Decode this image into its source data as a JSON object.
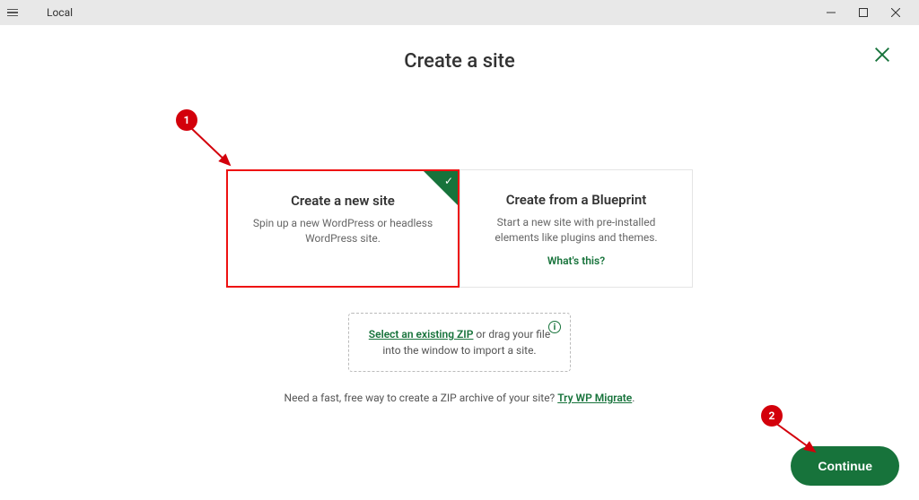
{
  "window": {
    "title": "Local"
  },
  "dialog": {
    "title": "Create a site"
  },
  "options": {
    "new_site": {
      "title": "Create a new site",
      "description": "Spin up a new WordPress or headless WordPress site."
    },
    "blueprint": {
      "title": "Create from a Blueprint",
      "description": "Start a new site with pre-installed elements like plugins and themes.",
      "whats_this": "What's this?"
    }
  },
  "zip": {
    "link_text": "Select an existing ZIP",
    "rest_text": " or drag your file into the window to import a site."
  },
  "migrate": {
    "prefix": "Need a fast, free way to create a ZIP archive of your site? ",
    "link": "Try WP Migrate",
    "suffix": "."
  },
  "buttons": {
    "continue": "Continue"
  },
  "callouts": {
    "c1": "1",
    "c2": "2"
  }
}
